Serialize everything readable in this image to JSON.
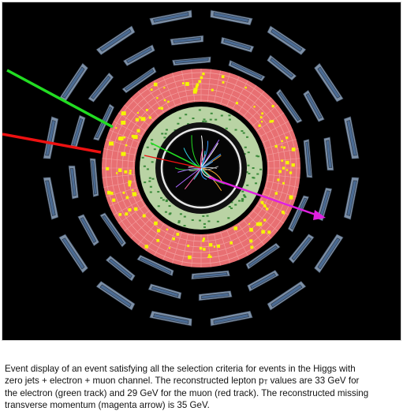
{
  "figure": {
    "icon": "event-display-diagram",
    "colors": {
      "background": "#000000",
      "muon_chamber": "#7c8fa6",
      "muon_chamber_inner": "#4b6b93",
      "calorimeter_red": "#e86f72",
      "calorimeter_grid": "#f4a0a0",
      "energy_deposit": "#f5f500",
      "tracker_ring": "#b9d3a4",
      "inner_detector": "#111111",
      "electron_track": "#22dd22",
      "muon_track": "#ee1111",
      "missing_et_arrow": "#e020e0"
    }
  },
  "caption": {
    "line1": "Event display of an event satisfying all the selection criteria for events in the Higgs with",
    "line2_pre": "zero jets + electron + muon channel.  The reconstructed lepton p",
    "line2_sub": "T",
    "line2_post": " values are 33 GeV for",
    "line3": "the electron (green track) and 29 GeV for the muon (red track).  The reconstructed missing",
    "line4": "transverse momentum (magenta arrow) is 35 GeV."
  }
}
